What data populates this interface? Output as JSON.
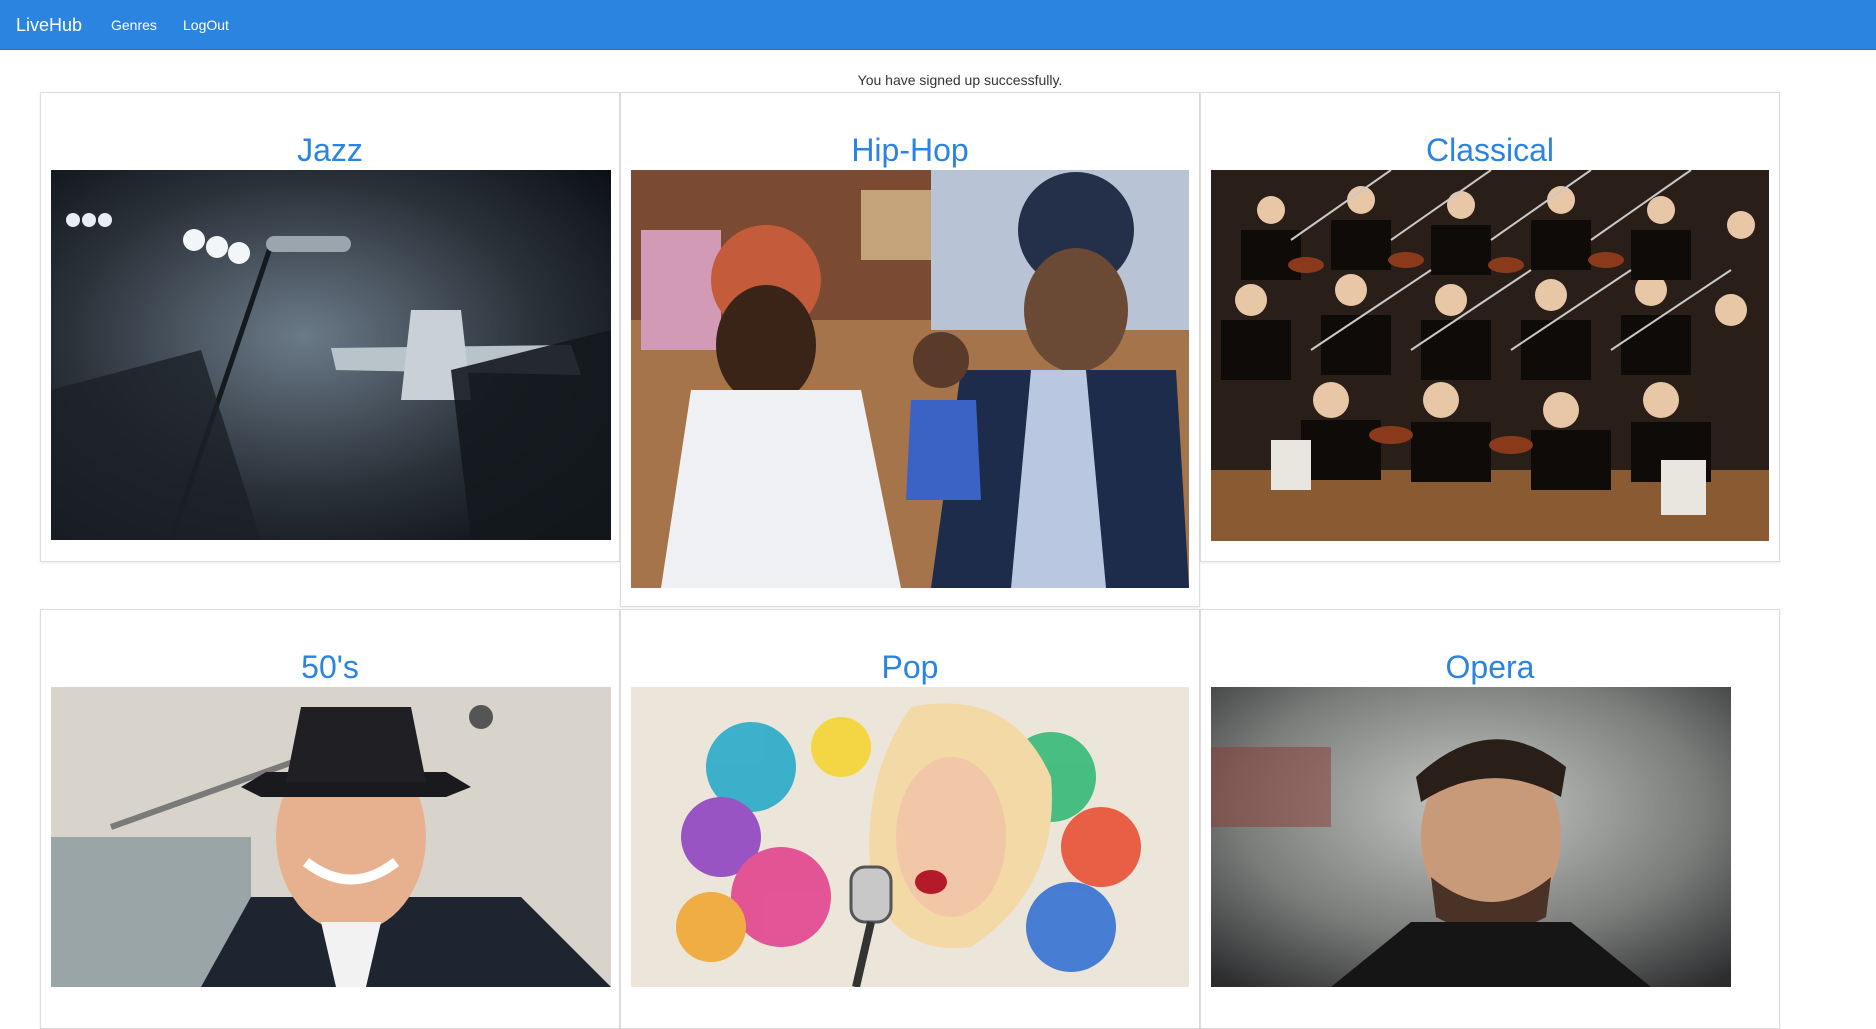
{
  "nav": {
    "brand": "LiveHub",
    "links": [
      "Genres",
      "LogOut"
    ],
    "color": "#2a84e0"
  },
  "notice": "You have signed up successfully.",
  "genres": [
    {
      "name": "Jazz",
      "image": "jazz-trumpet-microphone"
    },
    {
      "name": "Hip-Hop",
      "image": "hip-hop-street-artists"
    },
    {
      "name": "Classical",
      "image": "orchestra-violinists"
    },
    {
      "name": "50's",
      "image": "crooner-in-hat"
    },
    {
      "name": "Pop",
      "image": "singer-with-paint-splash"
    },
    {
      "name": "Opera",
      "image": "opera-singer-portrait"
    }
  ]
}
